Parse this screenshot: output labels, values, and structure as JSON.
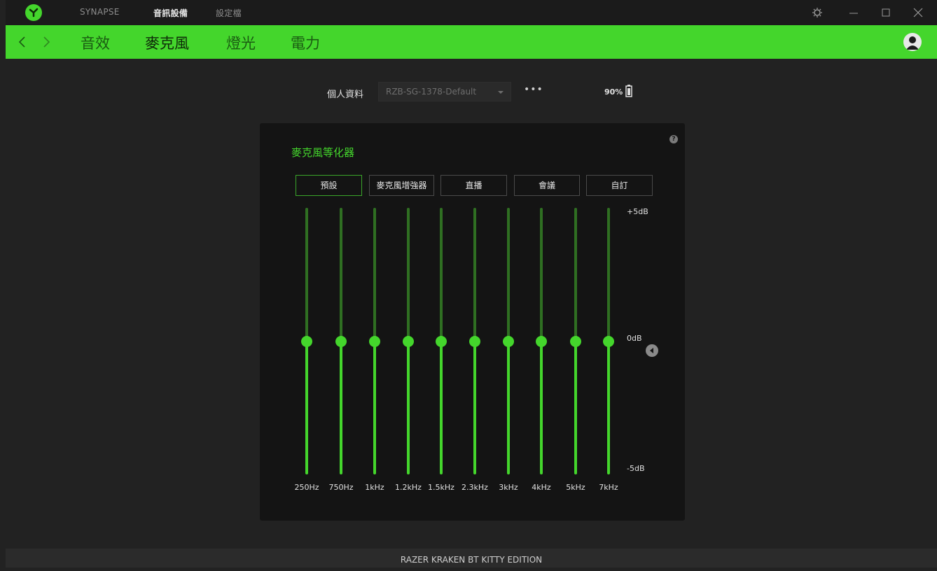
{
  "titlebar": {
    "tabs": [
      {
        "label": "SYNAPSE"
      },
      {
        "label": "音訊設備"
      },
      {
        "label": "設定檔"
      }
    ]
  },
  "subnav": {
    "tabs": [
      {
        "label": "音效"
      },
      {
        "label": "麥克風"
      },
      {
        "label": "燈光"
      },
      {
        "label": "電力"
      }
    ]
  },
  "profile": {
    "label": "個人資料",
    "selected": "RZB-SG-1378-Default",
    "more": "•••",
    "battery": "90%"
  },
  "equalizer": {
    "title": "麥克風等化器",
    "presets": [
      "預設",
      "麥克風增強器",
      "直播",
      "會議",
      "自訂"
    ],
    "selected_preset": "預設",
    "db_labels": {
      "top": "+5dB",
      "mid": "0dB",
      "bottom": "-5dB"
    },
    "bands": [
      {
        "freq": "250Hz",
        "gain_db": 0
      },
      {
        "freq": "750Hz",
        "gain_db": 0
      },
      {
        "freq": "1kHz",
        "gain_db": 0
      },
      {
        "freq": "1.2kHz",
        "gain_db": 0
      },
      {
        "freq": "1.5kHz",
        "gain_db": 0
      },
      {
        "freq": "2.3kHz",
        "gain_db": 0
      },
      {
        "freq": "3kHz",
        "gain_db": 0
      },
      {
        "freq": "4kHz",
        "gain_db": 0
      },
      {
        "freq": "5kHz",
        "gain_db": 0
      },
      {
        "freq": "7kHz",
        "gain_db": 0
      }
    ],
    "help": "?"
  },
  "footer": {
    "device_name": "RAZER KRAKEN BT KITTY EDITION"
  },
  "colors": {
    "accent": "#44d62c",
    "background": "#222222",
    "card": "#141414"
  }
}
